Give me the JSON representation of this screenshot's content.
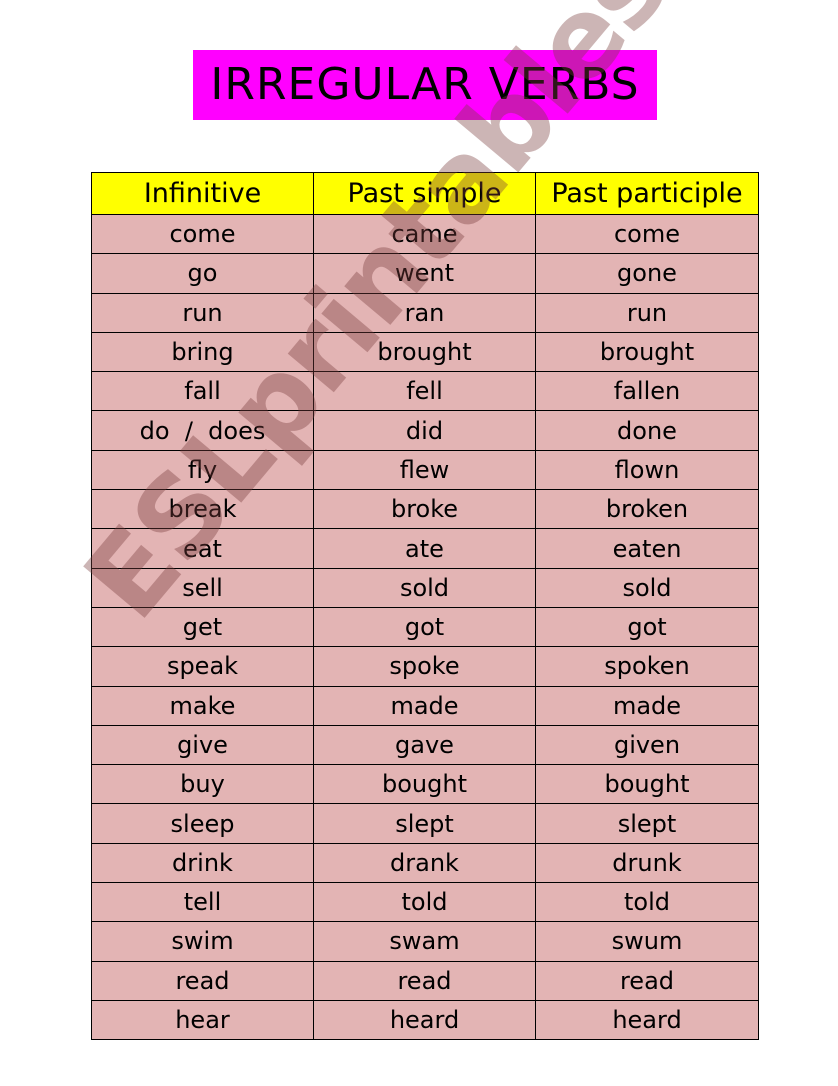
{
  "title": "IRREGULAR VERBS",
  "colors": {
    "title_background": "#ff00ff",
    "header_background": "#ffff00",
    "row_background": "#e3b4b4"
  },
  "watermark": "ESLprintables.com",
  "table": {
    "headers": [
      "Infinitive",
      "Past simple",
      "Past participle"
    ],
    "rows": [
      [
        "come",
        "came",
        "come"
      ],
      [
        "go",
        "went",
        "gone"
      ],
      [
        "run",
        "ran",
        "run"
      ],
      [
        "bring",
        "brought",
        "brought"
      ],
      [
        "fall",
        "fell",
        "fallen"
      ],
      [
        "do  /  does",
        "did",
        "done"
      ],
      [
        "fly",
        "flew",
        "flown"
      ],
      [
        "break",
        "broke",
        "broken"
      ],
      [
        "eat",
        "ate",
        "eaten"
      ],
      [
        "sell",
        "sold",
        "sold"
      ],
      [
        "get",
        "got",
        "got"
      ],
      [
        "speak",
        "spoke",
        "spoken"
      ],
      [
        "make",
        "made",
        "made"
      ],
      [
        "give",
        "gave",
        "given"
      ],
      [
        "buy",
        "bought",
        "bought"
      ],
      [
        "sleep",
        "slept",
        "slept"
      ],
      [
        "drink",
        "drank",
        "drunk"
      ],
      [
        "tell",
        "told",
        "told"
      ],
      [
        "swim",
        "swam",
        "swum"
      ],
      [
        "read",
        "read",
        "read"
      ],
      [
        "hear",
        "heard",
        "heard"
      ]
    ]
  }
}
